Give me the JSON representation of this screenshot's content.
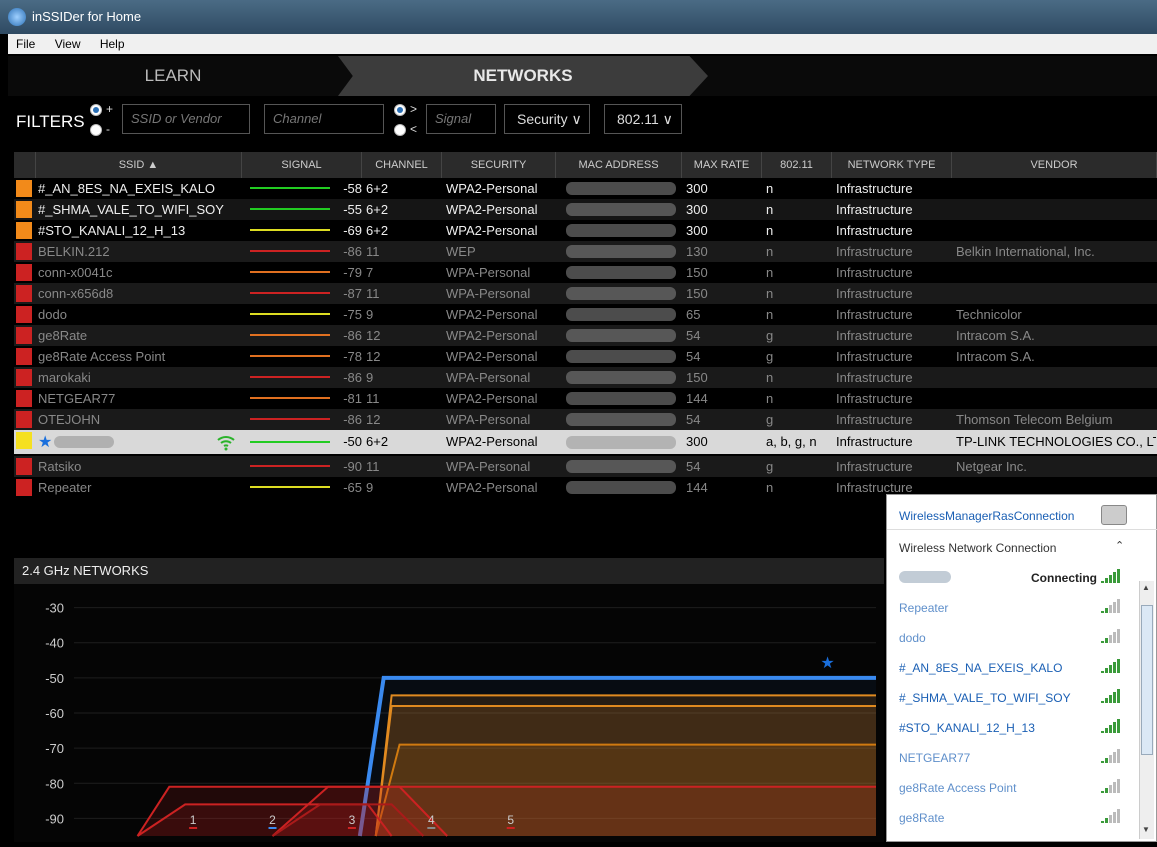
{
  "window": {
    "title": "inSSIDer for Home"
  },
  "menu": [
    "File",
    "View",
    "Help"
  ],
  "nav": {
    "learn": "LEARN",
    "networks": "NETWORKS"
  },
  "filters": {
    "label": "FILTERS",
    "plus": "+",
    "minus": "-",
    "gt": ">",
    "lt": "<",
    "ssid_placeholder": "SSID or Vendor",
    "channel_placeholder": "Channel",
    "signal_placeholder": "Signal",
    "security": "Security",
    "standard": "802.11"
  },
  "columns": [
    "SSID ▲",
    "SIGNAL",
    "CHANNEL",
    "SECURITY",
    "MAC ADDRESS",
    "MAX RATE",
    "802.11",
    "NETWORK TYPE",
    "VENDOR"
  ],
  "rows": [
    {
      "ssid": "#_AN_8ES_NA_EXEIS_KALO",
      "signal": "-58",
      "channel": "6+2",
      "security": "WPA2-Personal",
      "rate": "300",
      "std": "n",
      "type": "Infrastructure",
      "vendor": "",
      "color": "#f28a1a",
      "line": "#22cc22",
      "style": "normal"
    },
    {
      "ssid": "#_SHMA_VALE_TO_WIFI_SOY",
      "signal": "-55",
      "channel": "6+2",
      "security": "WPA2-Personal",
      "rate": "300",
      "std": "n",
      "type": "Infrastructure",
      "vendor": "",
      "color": "#f28a1a",
      "line": "#22cc22",
      "style": "alt"
    },
    {
      "ssid": "#STO_KANALI_12_H_13",
      "signal": "-69",
      "channel": "6+2",
      "security": "WPA2-Personal",
      "rate": "300",
      "std": "n",
      "type": "Infrastructure",
      "vendor": "",
      "color": "#f28a1a",
      "line": "#dddd22",
      "style": "normal"
    },
    {
      "ssid": "BELKIN.212",
      "signal": "-86",
      "channel": "11",
      "security": "WEP",
      "rate": "130",
      "std": "n",
      "type": "Infrastructure",
      "vendor": "Belkin International, Inc.",
      "color": "#cc2222",
      "line": "#cc2222",
      "style": "ghost"
    },
    {
      "ssid": "conn-x0041c",
      "signal": "-79",
      "channel": "7",
      "security": "WPA-Personal",
      "rate": "150",
      "std": "n",
      "type": "Infrastructure",
      "vendor": "",
      "color": "#cc2222",
      "line": "#e07020",
      "style": "ghost"
    },
    {
      "ssid": "conn-x656d8",
      "signal": "-87",
      "channel": "11",
      "security": "WPA-Personal",
      "rate": "150",
      "std": "n",
      "type": "Infrastructure",
      "vendor": "",
      "color": "#cc2222",
      "line": "#cc2222",
      "style": "ghost"
    },
    {
      "ssid": "dodo",
      "signal": "-75",
      "channel": "9",
      "security": "WPA2-Personal",
      "rate": "65",
      "std": "n",
      "type": "Infrastructure",
      "vendor": "Technicolor",
      "color": "#cc2222",
      "line": "#dddd22",
      "style": "ghost"
    },
    {
      "ssid": "ge8Rate",
      "signal": "-86",
      "channel": "12",
      "security": "WPA2-Personal",
      "rate": "54",
      "std": "g",
      "type": "Infrastructure",
      "vendor": "Intracom S.A.",
      "color": "#cc2222",
      "line": "#e07020",
      "style": "ghost"
    },
    {
      "ssid": "ge8Rate Access Point",
      "signal": "-78",
      "channel": "12",
      "security": "WPA2-Personal",
      "rate": "54",
      "std": "g",
      "type": "Infrastructure",
      "vendor": "Intracom S.A.",
      "color": "#cc2222",
      "line": "#e07020",
      "style": "ghost"
    },
    {
      "ssid": "marokaki",
      "signal": "-86",
      "channel": "9",
      "security": "WPA-Personal",
      "rate": "150",
      "std": "n",
      "type": "Infrastructure",
      "vendor": "",
      "color": "#cc2222",
      "line": "#cc2222",
      "style": "ghost"
    },
    {
      "ssid": "NETGEAR77",
      "signal": "-81",
      "channel": "11",
      "security": "WPA2-Personal",
      "rate": "144",
      "std": "n",
      "type": "Infrastructure",
      "vendor": "",
      "color": "#cc2222",
      "line": "#e07020",
      "style": "ghost"
    },
    {
      "ssid": "OTEJOHN",
      "signal": "-86",
      "channel": "12",
      "security": "WPA-Personal",
      "rate": "54",
      "std": "g",
      "type": "Infrastructure",
      "vendor": "Thomson Telecom Belgium",
      "color": "#cc2222",
      "line": "#cc2222",
      "style": "ghost"
    },
    {
      "ssid": "",
      "signal": "-50",
      "channel": "6+2",
      "security": "WPA2-Personal",
      "rate": "300",
      "std": "a, b, g, n",
      "type": "Infrastructure",
      "vendor": "TP-LINK TECHNOLOGIES CO., LT",
      "color": "#f5e020",
      "line": "#22cc22",
      "style": "sel"
    },
    {
      "ssid": "Ratsiko",
      "signal": "-90",
      "channel": "11",
      "security": "WPA-Personal",
      "rate": "54",
      "std": "g",
      "type": "Infrastructure",
      "vendor": "Netgear Inc.",
      "color": "#cc2222",
      "line": "#cc2222",
      "style": "ghost"
    },
    {
      "ssid": "Repeater",
      "signal": "-65",
      "channel": "9",
      "security": "WPA2-Personal",
      "rate": "144",
      "std": "n",
      "type": "Infrastructure",
      "vendor": "",
      "color": "#cc2222",
      "line": "#dddd22",
      "style": "ghost"
    }
  ],
  "panel": {
    "title": "2.4 GHz NETWORKS"
  },
  "chart_data": {
    "type": "area",
    "y_ticks": [
      -30,
      -40,
      -50,
      -60,
      -70,
      -80,
      -90
    ],
    "x_ticks": [
      "1",
      "2",
      "3",
      "4",
      "5"
    ],
    "series": [
      {
        "points": [
          [
            3.1,
            -95
          ],
          [
            3.4,
            -50
          ],
          [
            9.6,
            -50
          ]
        ],
        "color": "#3a8af0"
      },
      {
        "points": [
          [
            3.3,
            -95
          ],
          [
            3.5,
            -55
          ],
          [
            9.6,
            -55
          ]
        ],
        "color": "#e08a20"
      },
      {
        "points": [
          [
            3.3,
            -95
          ],
          [
            3.5,
            -58
          ],
          [
            9.6,
            -58
          ]
        ],
        "color": "#e08a20"
      },
      {
        "points": [
          [
            3.3,
            -95
          ],
          [
            3.6,
            -69
          ],
          [
            9.6,
            -69
          ]
        ],
        "color": "#d07a10"
      },
      {
        "points": [
          [
            0.3,
            -95
          ],
          [
            0.7,
            -81
          ],
          [
            9.6,
            -81
          ]
        ],
        "color": "#cc2222"
      },
      {
        "points": [
          [
            0.3,
            -95
          ],
          [
            0.9,
            -86
          ],
          [
            3.2,
            -86
          ],
          [
            3.5,
            -95
          ]
        ],
        "color": "#cc2222"
      },
      {
        "points": [
          [
            2.0,
            -95
          ],
          [
            2.7,
            -81
          ],
          [
            3.6,
            -81
          ],
          [
            4.2,
            -95
          ]
        ],
        "color": "#cc2222"
      },
      {
        "points": [
          [
            2.0,
            -95
          ],
          [
            2.6,
            -86
          ],
          [
            3.5,
            -86
          ],
          [
            3.9,
            -95
          ]
        ],
        "color": "#aa1a1a"
      }
    ],
    "ylim": [
      -95,
      -25
    ],
    "xlim": [
      -0.5,
      9.6
    ]
  },
  "popup": {
    "item1": "WirelessManagerRasConnection",
    "item2": "Wireless Network Connection",
    "connecting": "Connecting",
    "networks": [
      "Repeater",
      "dodo",
      "#_AN_8ES_NA_EXEIS_KALO",
      "#_SHMA_VALE_TO_WIFI_SOY",
      "#STO_KANALI_12_H_13",
      "NETGEAR77",
      "ge8Rate Access Point",
      "ge8Rate"
    ]
  }
}
